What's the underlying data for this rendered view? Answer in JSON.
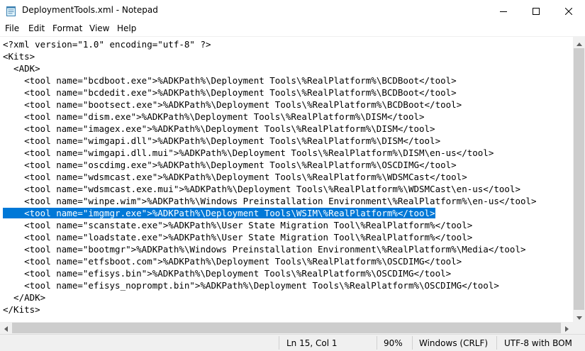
{
  "window": {
    "title": "DeploymentTools.xml - Notepad"
  },
  "menu": {
    "items": [
      "File",
      "Edit",
      "Format",
      "View",
      "Help"
    ]
  },
  "editor": {
    "selected_line_index": 14,
    "lines": [
      "<?xml version=\"1.0\" encoding=\"utf-8\" ?>",
      "<Kits>",
      "  <ADK>",
      "    <tool name=\"bcdboot.exe\">%ADKPath%\\Deployment Tools\\%RealPlatform%\\BCDBoot</tool>",
      "    <tool name=\"bcdedit.exe\">%ADKPath%\\Deployment Tools\\%RealPlatform%\\BCDBoot</tool>",
      "    <tool name=\"bootsect.exe\">%ADKPath%\\Deployment Tools\\%RealPlatform%\\BCDBoot</tool>",
      "    <tool name=\"dism.exe\">%ADKPath%\\Deployment Tools\\%RealPlatform%\\DISM</tool>",
      "    <tool name=\"imagex.exe\">%ADKPath%\\Deployment Tools\\%RealPlatform%\\DISM</tool>",
      "    <tool name=\"wimgapi.dll\">%ADKPath%\\Deployment Tools\\%RealPlatform%\\DISM</tool>",
      "    <tool name=\"wimgapi.dll.mui\">%ADKPath%\\Deployment Tools\\%RealPlatform%\\DISM\\en-us</tool>",
      "    <tool name=\"oscdimg.exe\">%ADKPath%\\Deployment Tools\\%RealPlatform%\\OSCDIMG</tool>",
      "    <tool name=\"wdsmcast.exe\">%ADKPath%\\Deployment Tools\\%RealPlatform%\\WDSMCast</tool>",
      "    <tool name=\"wdsmcast.exe.mui\">%ADKPath%\\Deployment Tools\\%RealPlatform%\\WDSMCast\\en-us</tool>",
      "    <tool name=\"winpe.wim\">%ADKPath%\\Windows Preinstallation Environment\\%RealPlatform%\\en-us</tool>",
      "    <tool name=\"imgmgr.exe\">%ADKPath%\\Deployment Tools\\WSIM\\%RealPlatform%</tool>",
      "    <tool name=\"scanstate.exe\">%ADKPath%\\User State Migration Tool\\%RealPlatform%</tool>",
      "    <tool name=\"loadstate.exe\">%ADKPath%\\User State Migration Tool\\%RealPlatform%</tool>",
      "    <tool name=\"bootmgr\">%ADKPath%\\Windows Preinstallation Environment\\%RealPlatform%\\Media</tool>",
      "    <tool name=\"etfsboot.com\">%ADKPath%\\Deployment Tools\\%RealPlatform%\\OSCDIMG</tool>",
      "    <tool name=\"efisys.bin\">%ADKPath%\\Deployment Tools\\%RealPlatform%\\OSCDIMG</tool>",
      "    <tool name=\"efisys_noprompt.bin\">%ADKPath%\\Deployment Tools\\%RealPlatform%\\OSCDIMG</tool>",
      "  </ADK>",
      "</Kits>"
    ]
  },
  "status": {
    "position": "Ln 15, Col 1",
    "zoom": "90%",
    "line_ending": "Windows (CRLF)",
    "encoding": "UTF-8 with BOM"
  },
  "colors": {
    "selection": "#0078d7",
    "scrollbar_track": "#f0f0f0",
    "scrollbar_thumb": "#cdcdcd"
  }
}
